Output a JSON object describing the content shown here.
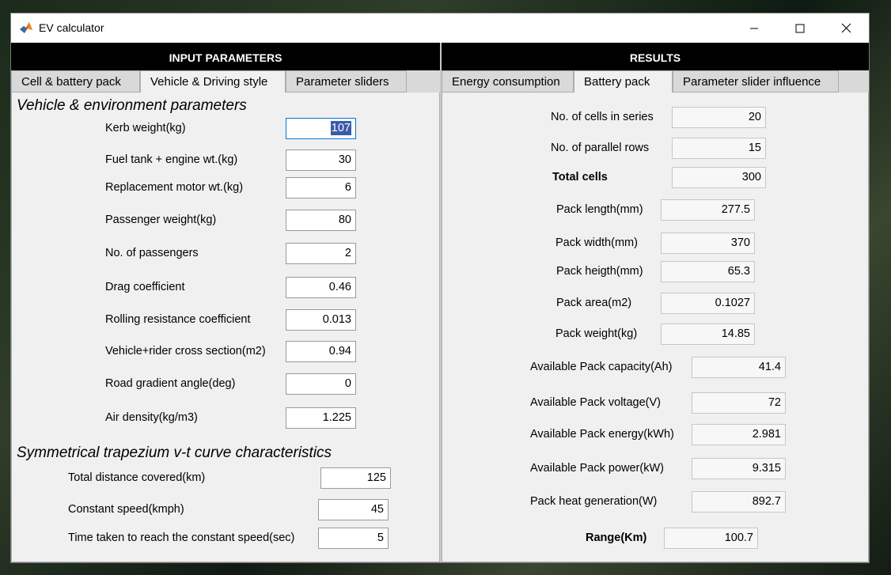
{
  "window": {
    "title": "EV calculator"
  },
  "left_panel": {
    "header": "INPUT PARAMETERS",
    "tabs": [
      {
        "label": "Cell & battery pack",
        "active": false
      },
      {
        "label": "Vehicle & Driving style",
        "active": true
      },
      {
        "label": "Parameter sliders",
        "active": false
      }
    ],
    "section1_title": "Vehicle & environment parameters",
    "section2_title": "Symmetrical trapezium v-t curve characteristics",
    "fields": [
      {
        "label": "Kerb weight(kg)",
        "value": "107"
      },
      {
        "label": "Fuel tank + engine wt.(kg)",
        "value": "30"
      },
      {
        "label": "Replacement motor wt.(kg)",
        "value": "6"
      },
      {
        "label": "Passenger weight(kg)",
        "value": "80"
      },
      {
        "label": "No. of passengers",
        "value": "2"
      },
      {
        "label": "Drag coefficient",
        "value": "0.46"
      },
      {
        "label": "Rolling resistance coefficient",
        "value": "0.013"
      },
      {
        "label": "Vehicle+rider cross section(m2)",
        "value": "0.94"
      },
      {
        "label": "Road gradient angle(deg)",
        "value": "0"
      },
      {
        "label": "Air density(kg/m3)",
        "value": "1.225"
      }
    ],
    "curve_fields": [
      {
        "label": "Total distance covered(km)",
        "value": "125"
      },
      {
        "label": "Constant speed(kmph)",
        "value": "45"
      },
      {
        "label": "Time taken to reach the constant speed(sec)",
        "value": "5"
      }
    ]
  },
  "right_panel": {
    "header": "RESULTS",
    "tabs": [
      {
        "label": "Energy consumption",
        "active": false
      },
      {
        "label": "Battery pack",
        "active": true
      },
      {
        "label": "Parameter slider influence",
        "active": false
      }
    ],
    "results": [
      {
        "label": "No. of cells in series",
        "value": "20"
      },
      {
        "label": "No. of parallel rows",
        "value": "15"
      },
      {
        "label": "Total cells",
        "value": "300"
      },
      {
        "label": "Pack length(mm)",
        "value": "277.5"
      },
      {
        "label": "Pack width(mm)",
        "value": "370"
      },
      {
        "label": "Pack heigth(mm)",
        "value": "65.3"
      },
      {
        "label": "Pack area(m2)",
        "value": "0.1027"
      },
      {
        "label": "Pack weight(kg)",
        "value": "14.85"
      },
      {
        "label": "Available Pack capacity(Ah)",
        "value": "41.4"
      },
      {
        "label": "Available Pack voltage(V)",
        "value": "72"
      },
      {
        "label": "Available Pack energy(kWh)",
        "value": "2.981"
      },
      {
        "label": "Available Pack power(kW)",
        "value": "9.315"
      },
      {
        "label": "Pack heat generation(W)",
        "value": "892.7"
      },
      {
        "label": "Range(Km)",
        "value": "100.7"
      }
    ]
  },
  "icons": {
    "app": "matlab-icon",
    "minimize": "minimize-icon",
    "maximize": "maximize-icon",
    "close": "close-icon"
  }
}
